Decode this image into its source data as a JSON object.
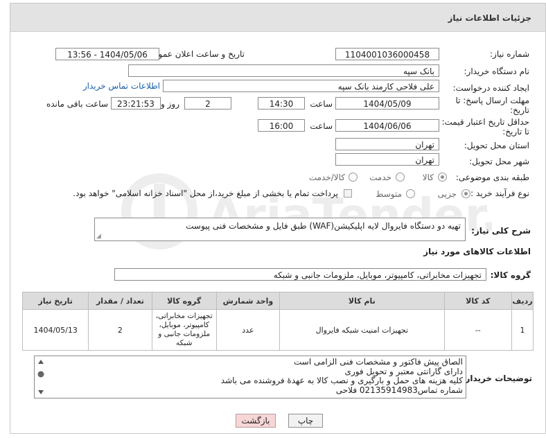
{
  "panel": {
    "title": "جزئیات اطلاعات نیاز"
  },
  "fields": {
    "need_number_label": "شماره نیاز:",
    "need_number": "1104001036000458",
    "announce_label": "تاریخ و ساعت اعلان عمومی:",
    "announce_value": "1404/05/06 - 13:56",
    "buyer_org_label": "نام دستگاه خریدار:",
    "buyer_org": "بانک سپه",
    "creator_label": "ایجاد کننده درخواست:",
    "creator": "علی فلاحی کارمند بانک سپه",
    "buyer_contact_link": "اطلاعات تماس خریدار",
    "deadline_label_1": "مهلت ارسال پاسخ: تا",
    "deadline_label_2": "تاریخ:",
    "deadline_date": "1404/05/09",
    "time_label": "ساعت",
    "deadline_time": "14:30",
    "days_value": "2",
    "days_label": "روز و",
    "remaining_value": "23:21:53",
    "remaining_label": "ساعت باقی مانده",
    "price_validity_label_1": "حداقل تاریخ اعتبار قیمت:",
    "price_validity_label_2": "تا تاریخ:",
    "price_validity_date": "1404/06/06",
    "price_validity_time": "16:00",
    "province_label": "استان محل تحویل:",
    "province": "تهران",
    "city_label": "شهر محل تحویل:",
    "city": "تهران",
    "category_label": "طبقه بندی موضوعی:",
    "category_options": [
      "کالا",
      "خدمت",
      "کالا/خدمت"
    ],
    "category_selected": "کالا",
    "process_label": "نوع فرآیند خرید :",
    "process_options": [
      "جزیی",
      "متوسط"
    ],
    "process_selected": "جزیی",
    "payment_note": "پرداخت تمام یا بخشی از مبلغ خرید،از محل \"اسناد خزانه اسلامی\" خواهد بود."
  },
  "description": {
    "label": "شرح کلی نیاز:",
    "value": "تهیه دو دستگاه فایروال لایه اپلیکیشن(WAF) طبق فایل و مشخصات فنی پیوست"
  },
  "goods_section": {
    "title": "اطلاعات کالاهای مورد نیاز",
    "group_label": "گروه کالا:",
    "group_value": "تجهیزات مخابراتی، کامپیوتر، موبایل، ملزومات جانبی و شبکه"
  },
  "table": {
    "headers": [
      "ردیف",
      "کد کالا",
      "نام کالا",
      "واحد شمارش",
      "گروه کالا",
      "تعداد / مقدار",
      "تاریخ نیاز"
    ],
    "rows": [
      {
        "row": "1",
        "code": "--",
        "name": "تجهیزات امنیت شبکه فایروال",
        "unit": "عدد",
        "group": "تجهیزات مخابراتی، کامپیوتر، موبایل، ملزومات جانبی و شبکه",
        "qty": "2",
        "date": "1404/05/13"
      }
    ]
  },
  "buyer_notes": {
    "label": "توضیحات خریدار:",
    "lines": [
      "الصاق پیش فاکتور و مشخصات فنی الزامی است",
      "دارای گارانتی معتبر و تحویل فوری",
      "کلیه هزینه های حمل و بارگیری و نصب کالا به عهدهٔ فروشنده می باشد",
      "شماره تماس02135914983 فلاحی"
    ]
  },
  "buttons": {
    "print": "چاپ",
    "back": "بازگشت"
  },
  "watermark": {
    "text": "AriaTender.neT"
  },
  "colors": {
    "header_bg": "#e3e3e3",
    "link": "#1a5fa8",
    "back_button": "#f6d6d6",
    "print_button": "#f2f2f2"
  }
}
